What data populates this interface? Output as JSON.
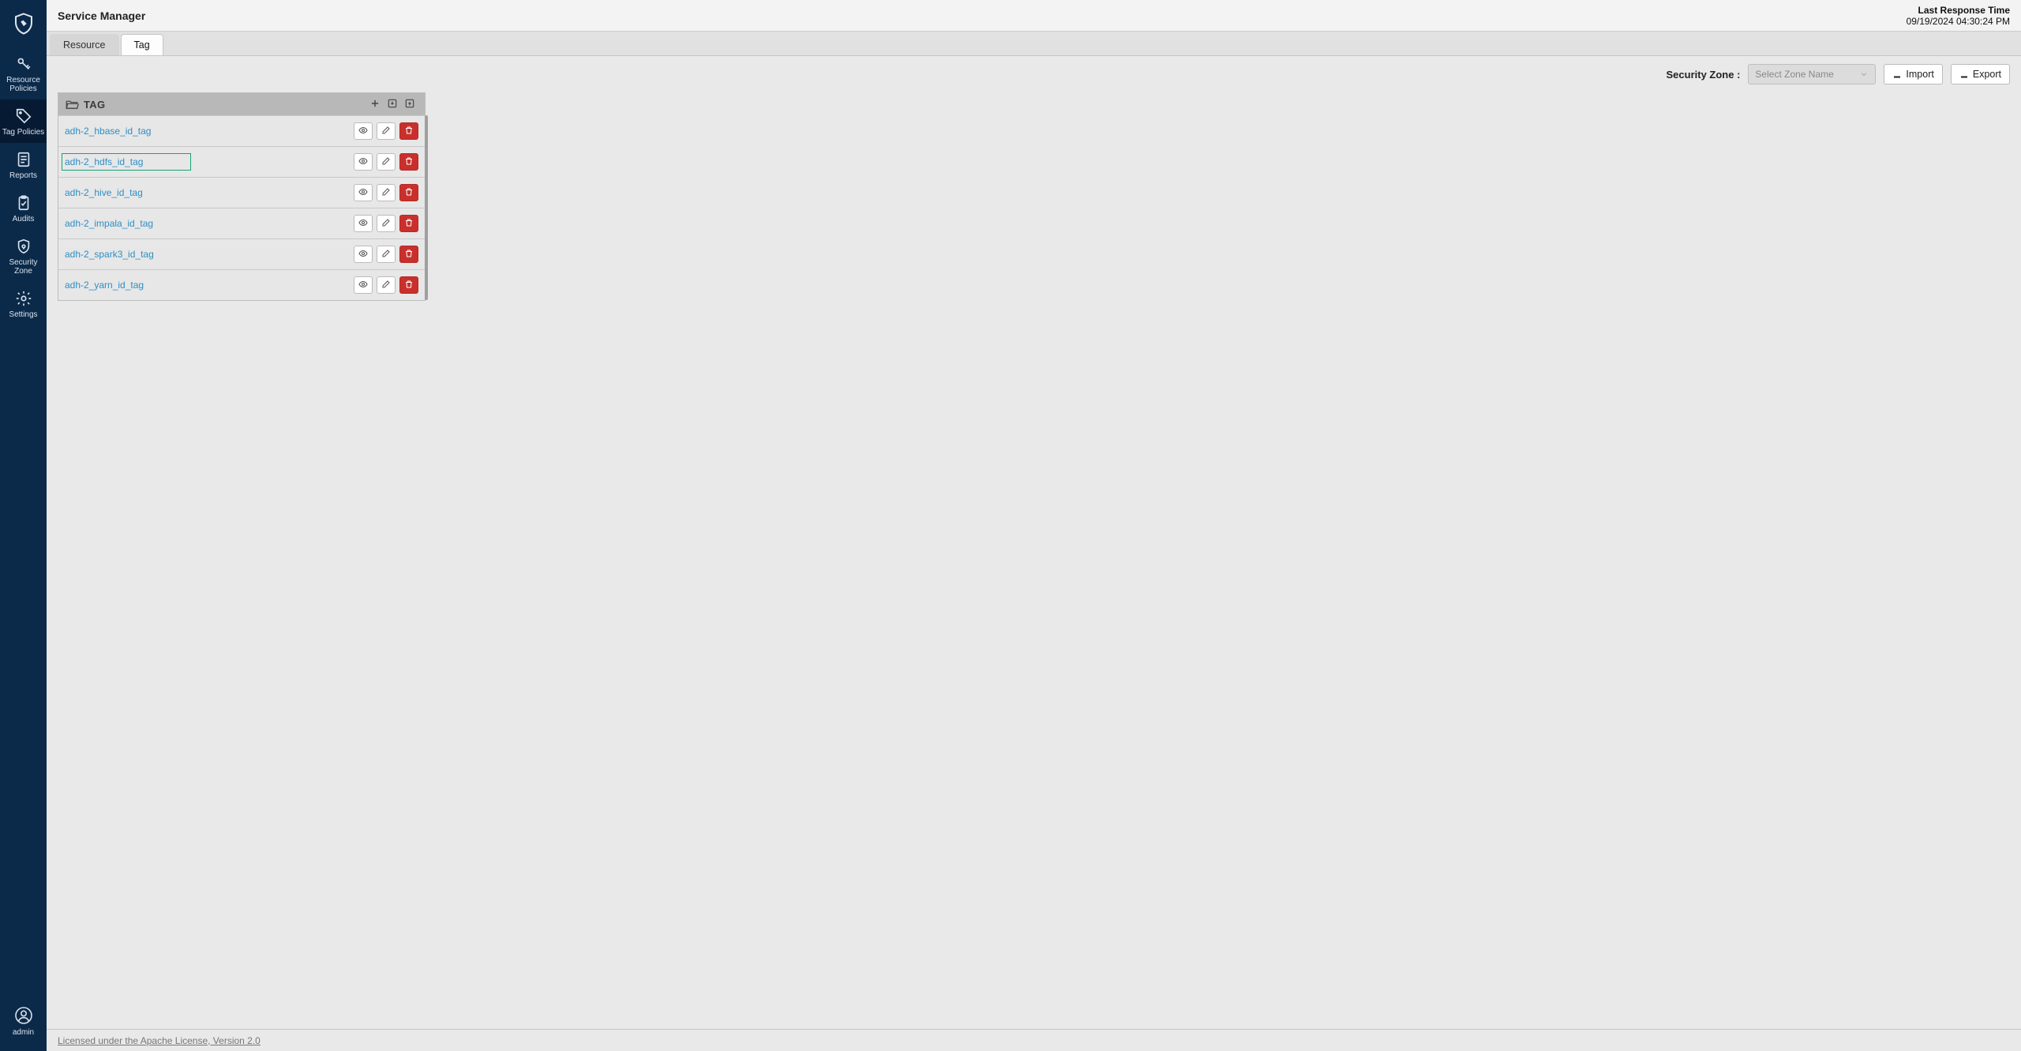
{
  "sidebar": {
    "items": [
      {
        "label": "Resource Policies",
        "icon": "key"
      },
      {
        "label": "Tag Policies",
        "icon": "tag"
      },
      {
        "label": "Reports",
        "icon": "report"
      },
      {
        "label": "Audits",
        "icon": "clipboard"
      },
      {
        "label": "Security Zone",
        "icon": "shield"
      },
      {
        "label": "Settings",
        "icon": "gear"
      }
    ],
    "active_index": 1,
    "user_label": "admin"
  },
  "header": {
    "title": "Service Manager",
    "last_response_label": "Last Response Time",
    "last_response_value": "09/19/2024 04:30:24 PM"
  },
  "tabs": [
    {
      "label": "Resource",
      "active": false
    },
    {
      "label": "Tag",
      "active": true
    }
  ],
  "toolbar": {
    "security_zone_label": "Security Zone :",
    "zone_placeholder": "Select Zone Name",
    "import_label": "Import",
    "export_label": "Export"
  },
  "panel": {
    "title": "TAG",
    "services": [
      {
        "name": "adh-2_hbase_id_tag",
        "highlighted": false
      },
      {
        "name": "adh-2_hdfs_id_tag",
        "highlighted": true
      },
      {
        "name": "adh-2_hive_id_tag",
        "highlighted": false
      },
      {
        "name": "adh-2_impala_id_tag",
        "highlighted": false
      },
      {
        "name": "adh-2_spark3_id_tag",
        "highlighted": false
      },
      {
        "name": "adh-2_yarn_id_tag",
        "highlighted": false
      }
    ]
  },
  "footer": {
    "license_text": "Licensed under the Apache License, Version 2.0"
  }
}
